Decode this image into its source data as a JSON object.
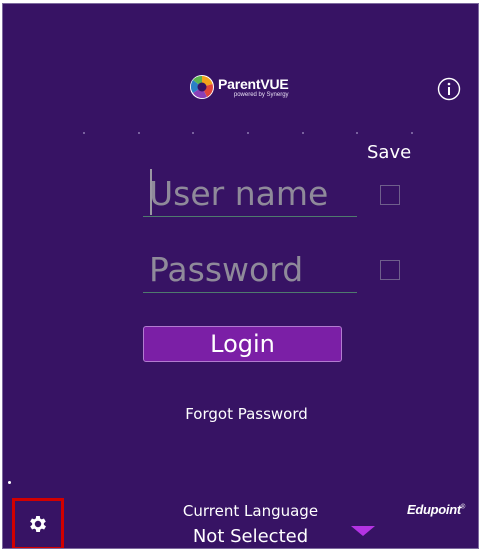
{
  "header": {
    "logo_title": "ParentVUE",
    "logo_subtitle": "powered by Synergy"
  },
  "login_form": {
    "save_label": "Save",
    "username": {
      "placeholder": "User name",
      "value": ""
    },
    "password": {
      "placeholder": "Password",
      "value": ""
    },
    "login_label": "Login",
    "forgot_label": "Forgot Password"
  },
  "footer": {
    "language_label": "Current Language",
    "language_value": "Not Selected",
    "brand": "Edupoint"
  },
  "icons": {
    "info": "info-icon",
    "settings": "gear-icon",
    "dropdown": "caret-down-icon"
  },
  "colors": {
    "background": "#371364",
    "button": "#7b1fa6",
    "dropdown_arrow": "#b433e3",
    "highlight_box": "#d20000"
  }
}
